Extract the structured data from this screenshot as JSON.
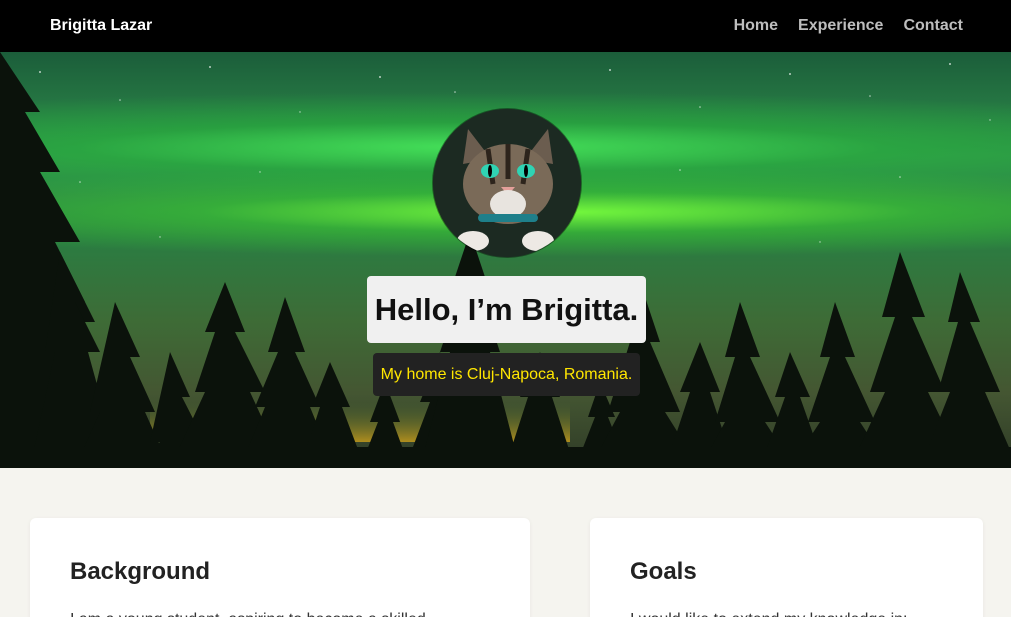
{
  "nav": {
    "brand": "Brigitta Lazar",
    "links": [
      "Home",
      "Experience",
      "Contact"
    ]
  },
  "hero": {
    "title": "Hello, I’m Brigitta.",
    "subtitle": "My home is Cluj-Napoca, Romania.",
    "avatar_icon": "cat-portrait-icon"
  },
  "cards": [
    {
      "title": "Background",
      "text": "I am a young student, aspiring to become a skilled"
    },
    {
      "title": "Goals",
      "text": "I would like to extend my knowledge in:"
    }
  ],
  "colors": {
    "navbar_bg": "#000000",
    "nav_link": "#bdbdbd",
    "subtitle_text": "#ffe600",
    "subtitle_bg": "#222222",
    "page_bg": "#f5f4ef"
  }
}
